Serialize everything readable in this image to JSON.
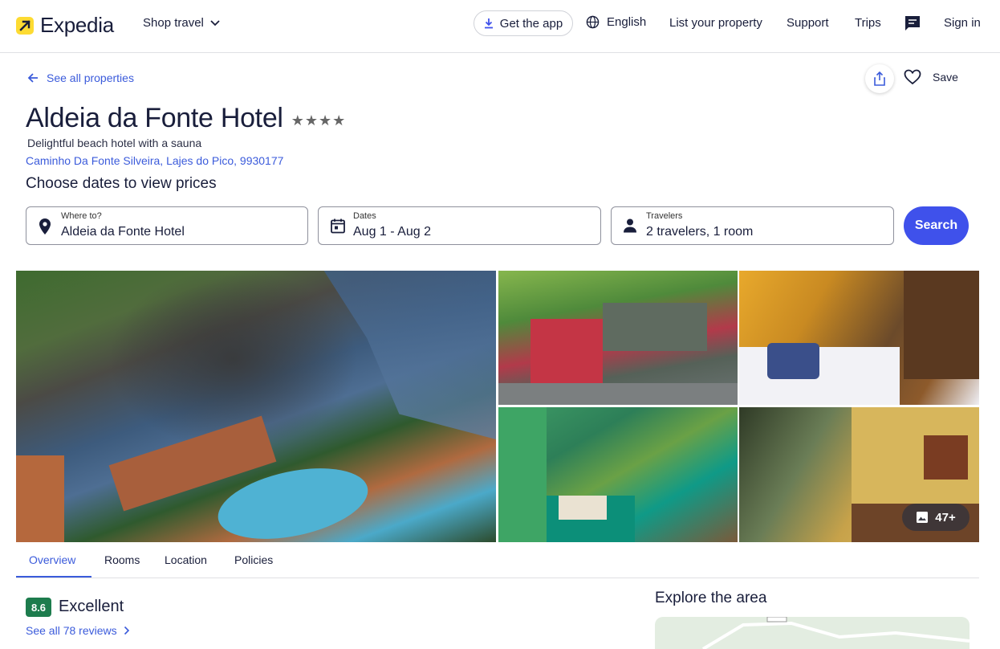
{
  "header": {
    "brand": "Expedia",
    "shop_travel": "Shop travel",
    "get_app": "Get the app",
    "language": "English",
    "list_property": "List your property",
    "support": "Support",
    "trips": "Trips",
    "sign_in": "Sign in"
  },
  "page": {
    "back_link": "See all properties",
    "save_label": "Save",
    "hotel_name": "Aldeia da Fonte Hotel",
    "stars": "★★★★",
    "star_rating": 4,
    "tagline": "Delightful beach hotel with a sauna",
    "address": "Caminho Da Fonte Silveira, Lajes do Pico, 9930177",
    "choose_dates": "Choose dates to view prices"
  },
  "search": {
    "where_label": "Where to?",
    "where_value": "Aldeia da Fonte Hotel",
    "dates_label": "Dates",
    "dates_value": "Aug 1 - Aug 2",
    "travelers_label": "Travelers",
    "travelers_value": "2 travelers, 1 room",
    "search_button": "Search"
  },
  "gallery": {
    "more_photos": "47+"
  },
  "tabs": [
    {
      "label": "Overview",
      "active": true
    },
    {
      "label": "Rooms",
      "active": false
    },
    {
      "label": "Location",
      "active": false
    },
    {
      "label": "Policies",
      "active": false
    }
  ],
  "reviews": {
    "score": "8.6",
    "rating_text": "Excellent",
    "see_all": "See all 78 reviews"
  },
  "explore": {
    "title": "Explore the area"
  },
  "colors": {
    "brand_yellow": "#fddb32",
    "link_blue": "#3b5bdb",
    "search_button": "#3f51eb",
    "score_green": "#1d7c4d"
  }
}
